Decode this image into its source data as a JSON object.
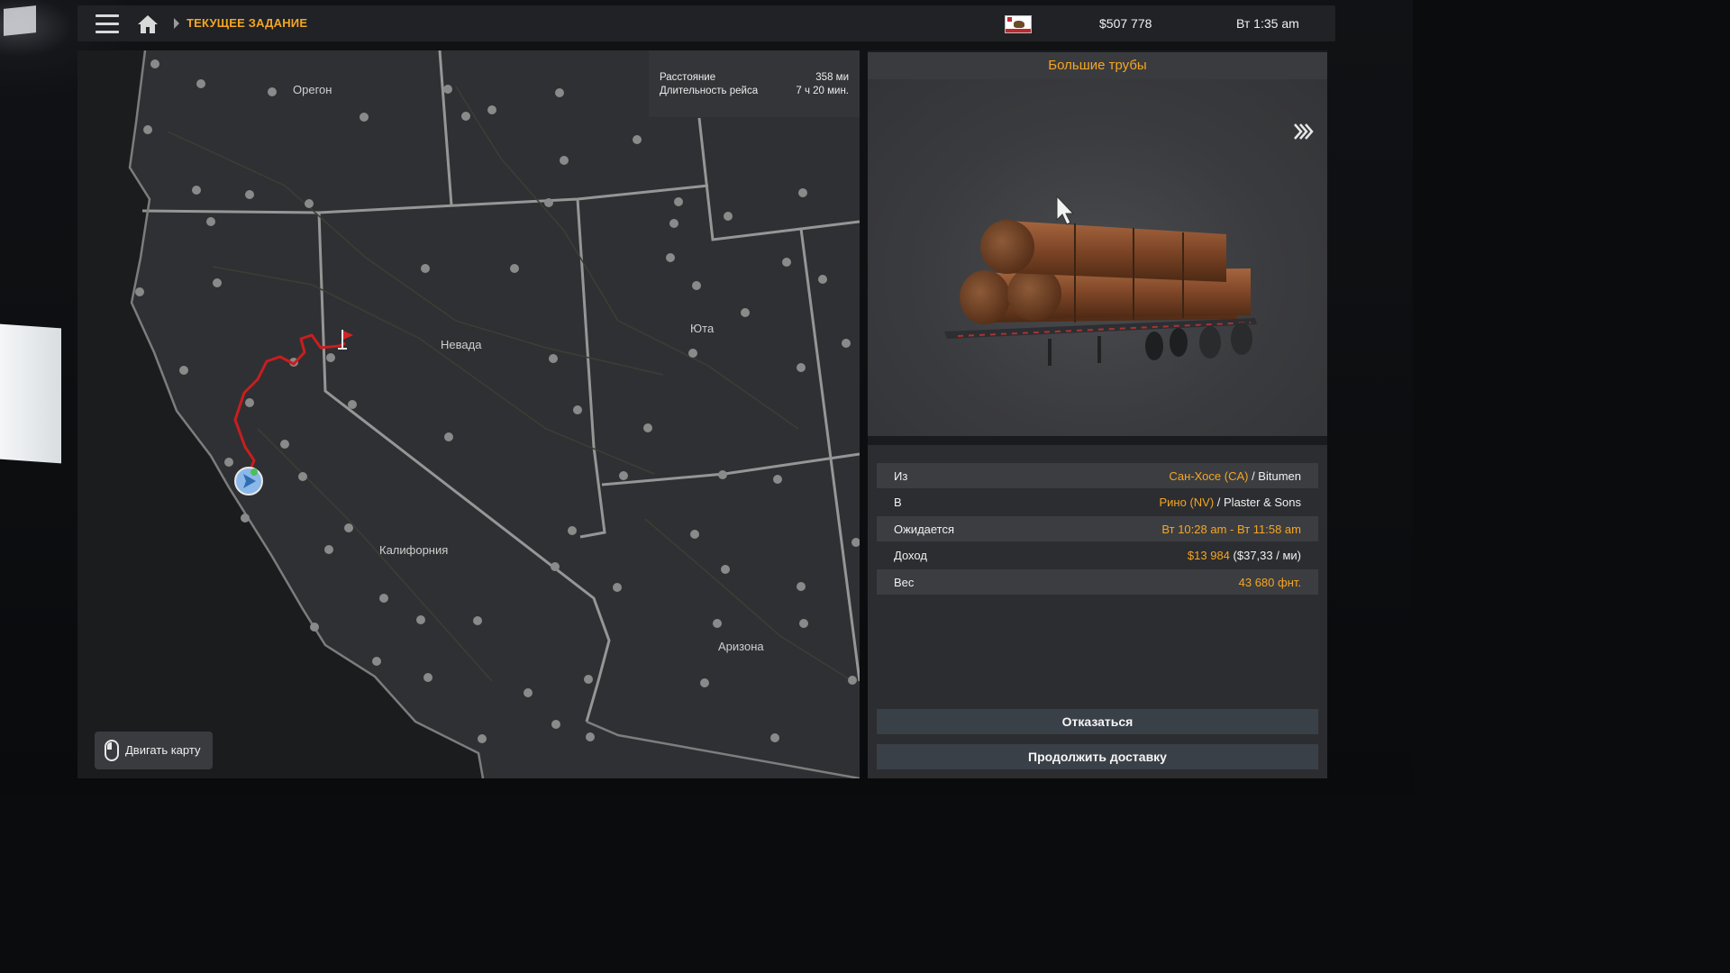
{
  "topbar": {
    "breadcrumb": "ТЕКУЩЕЕ ЗАДАНИЕ",
    "money": "$507 778",
    "clock": "Вт 1:35 am"
  },
  "map": {
    "states": [
      "Орегон",
      "Невада",
      "Юта",
      "Калифорния",
      "Аризона"
    ],
    "route_info": {
      "distance_label": "Расстояние",
      "distance_value": "358 ми",
      "duration_label": "Длительность рейса",
      "duration_value": "7 ч 20 мин."
    },
    "move_map_label": "Двигать карту"
  },
  "cargo": {
    "title": "Большие трубы",
    "details": [
      {
        "key": "Из",
        "val_accent": "Сан-Хосе (CA)",
        "val_plain": " / Bitumen"
      },
      {
        "key": "В",
        "val_accent": "Рино (NV)",
        "val_plain": " / Plaster & Sons"
      },
      {
        "key": "Ожидается",
        "val_accent": "Вт 10:28 am - Вт 11:58 am",
        "val_plain": ""
      },
      {
        "key": "Доход",
        "val_accent": "$13 984",
        "val_plain": " ($37,33 / ми)"
      },
      {
        "key": "Вес",
        "val_accent": "43 680 фнт.",
        "val_plain": ""
      }
    ],
    "actions": {
      "decline": "Отказаться",
      "continue": "Продолжить доставку"
    }
  },
  "colors": {
    "accent": "#f5a623",
    "route": "#c81e1e"
  }
}
